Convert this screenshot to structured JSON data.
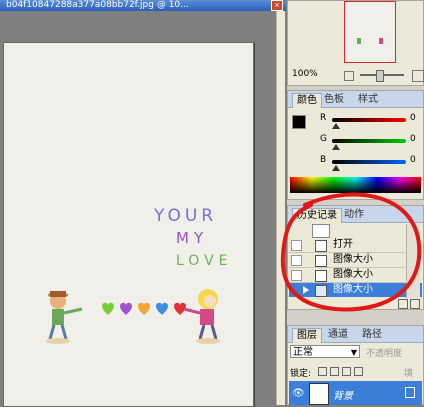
{
  "document": {
    "title": "b04f10847288a377a08bb72f.jpg @ 10...",
    "close_label": "×"
  },
  "artwork": {
    "line1": "YOUR",
    "line2": "MY",
    "line3": "LOVE"
  },
  "navigator": {
    "zoom": "100%"
  },
  "color_panel": {
    "tabs": [
      "颜色",
      "色板",
      "样式"
    ],
    "channels": [
      {
        "label": "R",
        "value": "0"
      },
      {
        "label": "G",
        "value": "0"
      },
      {
        "label": "B",
        "value": "0"
      }
    ],
    "foreground_color": "#000000",
    "background_color": "#ffffff"
  },
  "history_panel": {
    "tabs": [
      "历史记录",
      "动作"
    ],
    "items": [
      {
        "label": "打开"
      },
      {
        "label": "图像大小"
      },
      {
        "label": "图像大小"
      },
      {
        "label": "图像大小"
      }
    ],
    "selected_index": 3,
    "annotation_color": "#e01818"
  },
  "layers_panel": {
    "tabs": [
      "图层",
      "通道",
      "路径"
    ],
    "blend_mode": "正常",
    "opacity_label": "不透明度",
    "lock_label": "锁定:",
    "fill_label": "填",
    "layer_name": "背景"
  }
}
